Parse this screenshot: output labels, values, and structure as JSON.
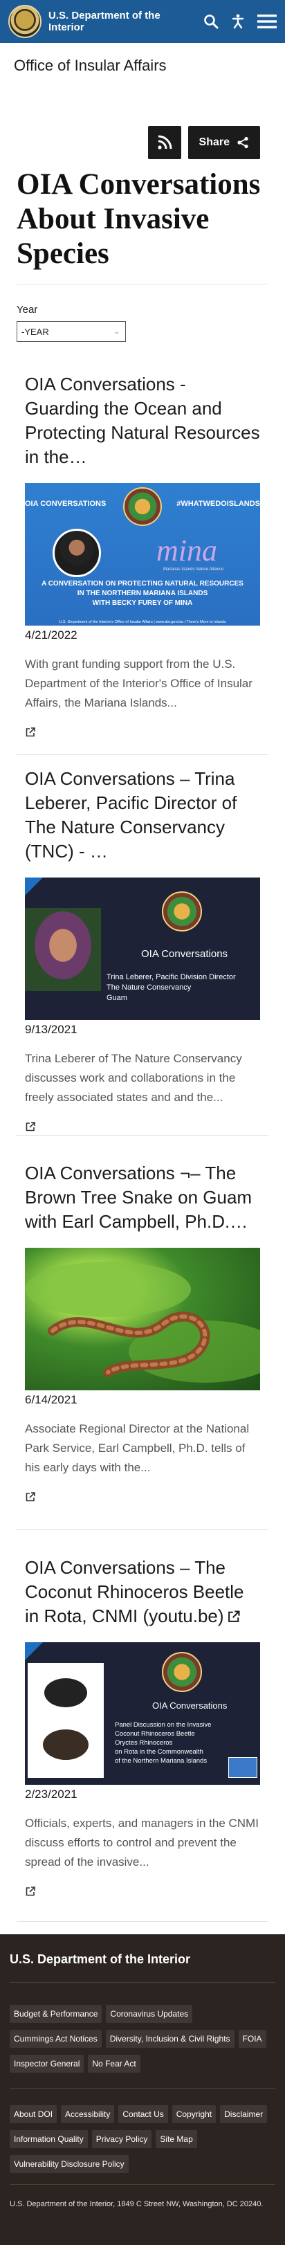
{
  "header": {
    "agency_name": "U.S. Department of the Interior",
    "icons": [
      "search-icon",
      "accessibility-icon",
      "menu-icon"
    ]
  },
  "office_name": "Office of Insular Affairs",
  "share": {
    "label": "Share"
  },
  "page_title": "OIA Conversations About Invasive Species",
  "filter": {
    "label": "Year",
    "selected": "-YEAR"
  },
  "articles": [
    {
      "title": "OIA Conversations - Guarding the Ocean and Protecting Natural Resources in the…",
      "image": {
        "left_tag": "OIA CONVERSATIONS",
        "right_tag": "#WHATWEDOISLANDS",
        "logo_text": "mina",
        "logo_sub": "Marianas Islands Nature Alliance",
        "caption_1": "A CONVERSATION ON PROTECTING NATURAL RESOURCES",
        "caption_2": "IN THE NORTHERN MARIANA ISLANDS",
        "caption_3": "WITH BECKY FUREY OF MINA",
        "footer": "U.S. Department of the Interior's Office of Insular Affairs | www.doi.gov/oia | There's More to Islands"
      },
      "date": "4/21/2022",
      "description": "With grant funding support from the U.S. Department of the Interior's Office of Insular Affairs, the Mariana Islands..."
    },
    {
      "title": "OIA Conversations – Trina Leberer, Pacific Director of The Nature Conservancy (TNC) - …",
      "image": {
        "heading": "OIA Conversations",
        "line_1": "Trina Leberer, Pacific Division Director",
        "line_2": "The Nature Conservancy",
        "line_3": "Guam"
      },
      "date": "9/13/2021",
      "description": "Trina Leberer of The Nature Conservancy discusses work and collaborations in the freely associated states and and the..."
    },
    {
      "title": "OIA Conversations ¬– The Brown Tree Snake on Guam with Earl Campbell, Ph.D.…",
      "date": "6/14/2021",
      "description": "Associate Regional Director at the National Park Service, Earl Campbell, Ph.D. tells of his early days with the..."
    },
    {
      "title": "OIA Conversations – The Coconut Rhinoceros Beetle in Rota, CNMI (youtu.be)",
      "image": {
        "heading": "OIA Conversations",
        "line_1": "Panel Discussion on the Invasive",
        "line_2": "Coconut Rhinoceros Beetle",
        "line_3": "Oryctes Rhinoceros",
        "line_4": "on Rota in the Commonwealth",
        "line_5": "of the Northern Mariana Islands"
      },
      "date": "2/23/2021",
      "description": "Officials, experts, and managers in the CNMI discuss efforts to control and prevent the spread of the invasive..."
    }
  ],
  "footer": {
    "title": "U.S. Department of the Interior",
    "links_primary": [
      "Budget & Performance",
      "Coronavirus Updates",
      "Cummings Act Notices",
      "Diversity, Inclusion & Civil Rights",
      "FOIA",
      "Inspector General",
      "No Fear Act"
    ],
    "links_secondary": [
      "About DOI",
      "Accessibility",
      "Contact Us",
      "Copyright",
      "Disclaimer",
      "Information Quality",
      "Privacy Policy",
      "Site Map",
      "Vulnerability Disclosure Policy"
    ],
    "address": "U.S. Department of the Interior, 1849 C Street NW, Washington, DC 20240."
  },
  "colors": {
    "header_bg": "#1c5b95",
    "footer_bg": "#2b2420",
    "button_bg": "#1b1b1b"
  }
}
